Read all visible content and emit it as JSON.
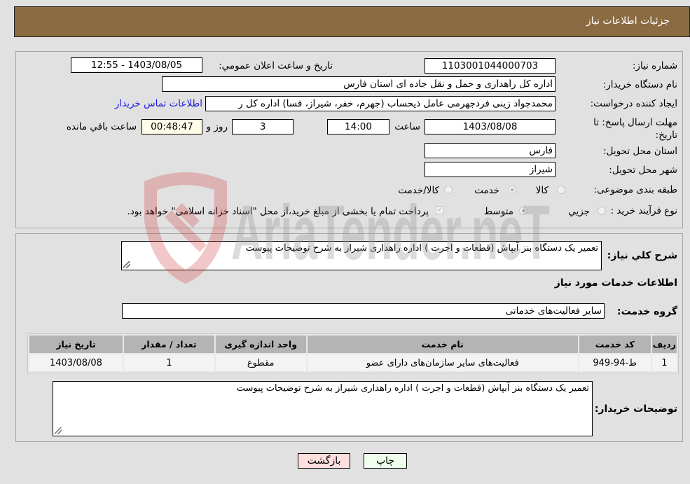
{
  "header": {
    "title": "جزئیات اطلاعات نیاز"
  },
  "form": {
    "need_number": {
      "label": "شماره نیاز:",
      "value": "1103001044000703"
    },
    "announce_datetime": {
      "label": "تاریخ و ساعت اعلان عمومي:",
      "value": "1403/08/05 - 12:55"
    },
    "buyer_org": {
      "label": "نام دستگاه خریدار:",
      "value": "اداره کل راهداری و حمل و نقل جاده ای استان فارس"
    },
    "creator": {
      "label": "ایجاد کننده درخواست:",
      "value": "محمدجواد زینی فردجهرمی عامل ذیحساب (جهرم، خفر، شیراز، فسا) اداره کل ر",
      "contact_link": "اطلاعات تماس خریدار"
    },
    "deadline": {
      "label": "مهلت ارسال پاسخ: تا تاریخ:",
      "date": "1403/08/08",
      "time_label": "ساعت",
      "time": "14:00",
      "days": "3",
      "days_label": "روز و",
      "remaining": "00:48:47",
      "remaining_label": "ساعت باقي مانده"
    },
    "province": {
      "label": "استان محل تحویل:",
      "value": "فارس"
    },
    "city": {
      "label": "شهر محل تحویل:",
      "value": "شیراز"
    },
    "category": {
      "label": "طبقه بندی موضوعی:",
      "options": [
        "کالا",
        "خدمت",
        "کالا/خدمت"
      ],
      "selected": "خدمت"
    },
    "process_type": {
      "label": "نوع فرآیند خرید :",
      "options": [
        "جزيي",
        "متوسط"
      ],
      "selected": "متوسط",
      "treasury_note": "پرداخت تمام یا بخشی از مبلغ خرید،از محل \"اسناد خزانه اسلامی\" خواهد بود.",
      "treasury_checked": true
    }
  },
  "details": {
    "description_label": "شرح كلي نياز:",
    "description": "تعمیر یک دستگاه بنز آبپاش (قطعات و اجرت ) اداره راهداری شیراز به شرح توضیحات پیوست",
    "services_heading": "اطلاعات خدمات مورد نياز",
    "service_group_label": "گروه خدمت:",
    "service_group": "سایر فعالیت‌های خدماتی",
    "table": {
      "headers": [
        "ردیف",
        "کد خدمت",
        "نام خدمت",
        "واحد اندازه گیری",
        "تعداد / مقدار",
        "تاریخ نیاز"
      ],
      "rows": [
        [
          "1",
          "ط-94-949",
          "فعالیت‌های سایر سازمان‌های دارای عضو",
          "مقطوع",
          "1",
          "1403/08/08"
        ]
      ]
    },
    "buyer_notes_label": "توضیحات خریدار:",
    "buyer_notes": "تعمیر یک دستگاه بنز آبپاش (قطعات و اجرت ) اداره راهداری شیراز به شرح توضیحات پیوست"
  },
  "buttons": {
    "print": "چاپ",
    "back": "بازگشت"
  },
  "colors": {
    "header_bg": "#8b6b42",
    "print_bg": "#eeffee",
    "back_bg": "#ffdede",
    "link": "#1a1ae0"
  },
  "watermark": {
    "text": "AriaTender.neT"
  }
}
